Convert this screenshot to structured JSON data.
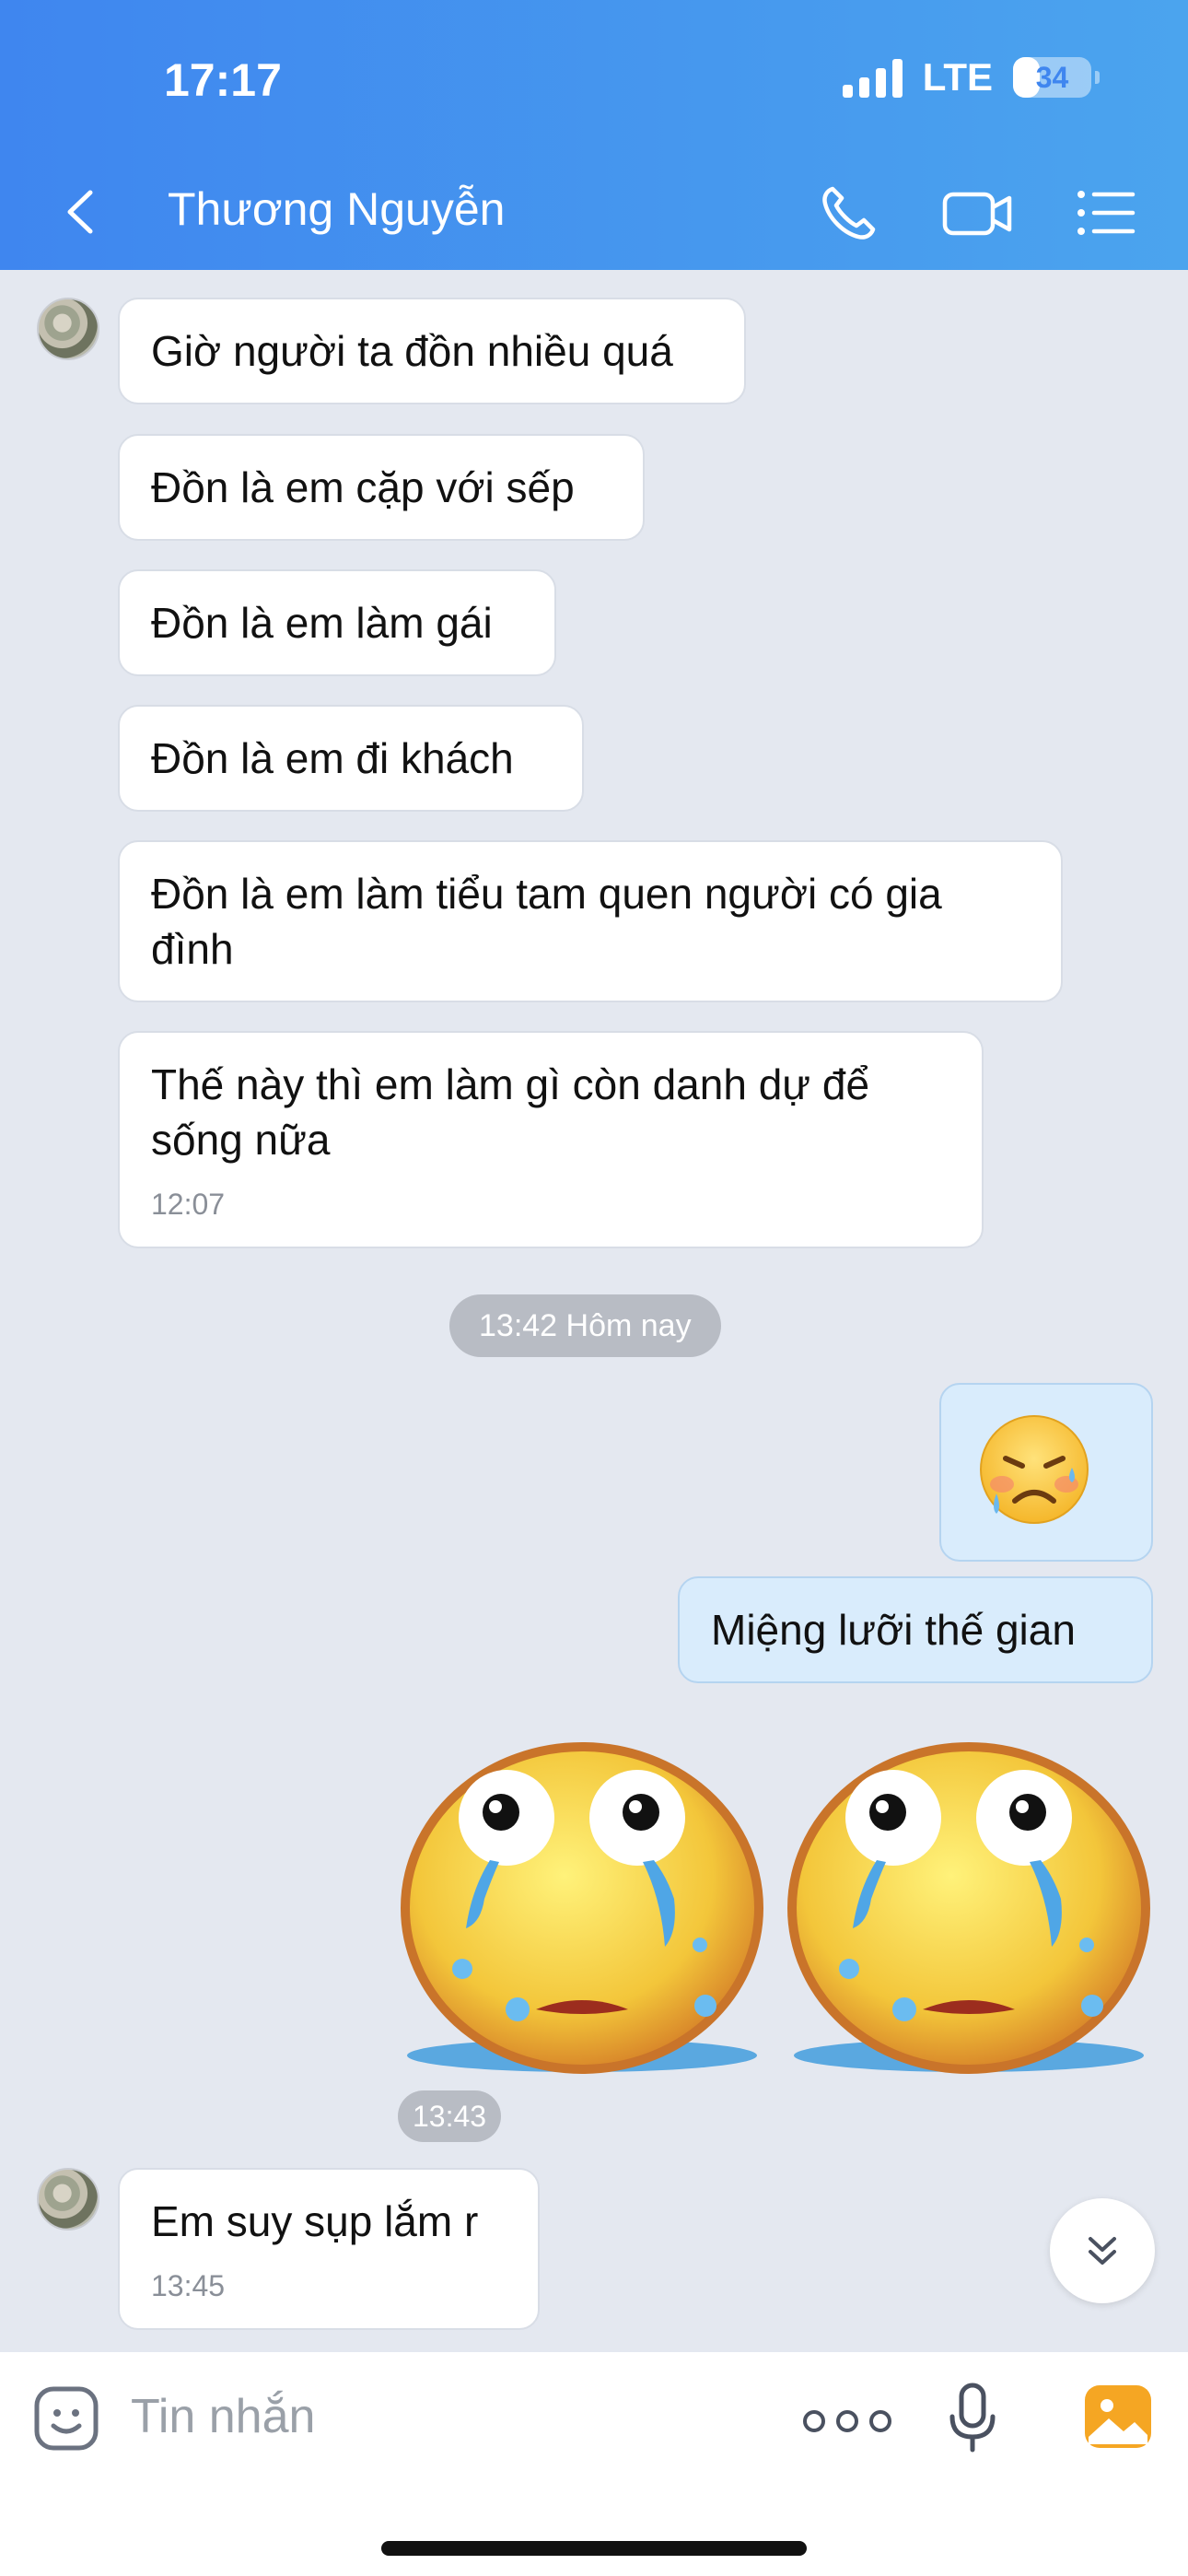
{
  "status_bar": {
    "time": "17:17",
    "network": "LTE",
    "battery": "34",
    "battery_level": 0.34
  },
  "header": {
    "contact_name": "Thương Nguyễn"
  },
  "messages": [
    {
      "text": "Giờ người ta đồn nhiều quá"
    },
    {
      "text": "Đồn là em cặp với sếp"
    },
    {
      "text": "Đồn là em làm gái"
    },
    {
      "text": "Đồn là em đi khách"
    },
    {
      "text": "Đồn là em làm tiểu tam quen người có gia đình"
    },
    {
      "text": "Thế này thì em làm gì còn danh dự để sống nữa",
      "time": "12:07"
    },
    {
      "text": "Miệng lưỡi thế gian"
    },
    {
      "text": "Em suy sụp lắm r",
      "time": "13:45"
    }
  ],
  "date_separator": "13:42 Hôm nay",
  "sticker_time": "13:43",
  "input": {
    "placeholder": "Tin nhắn"
  },
  "icons": {
    "back": "chevron-left-icon",
    "call": "phone-icon",
    "video": "video-camera-icon",
    "menu": "list-menu-icon",
    "sticker": "emoji-face-icon",
    "more": "more-dots-icon",
    "mic": "microphone-icon",
    "image": "image-gallery-icon",
    "scroll": "double-chevron-down-icon"
  },
  "colors": {
    "header_start": "#3f86ef",
    "header_end": "#4ba4ee",
    "chat_bg": "#e4e8f0",
    "my_bubble": "#d9ecfc",
    "image_icon": "#f5a623"
  }
}
